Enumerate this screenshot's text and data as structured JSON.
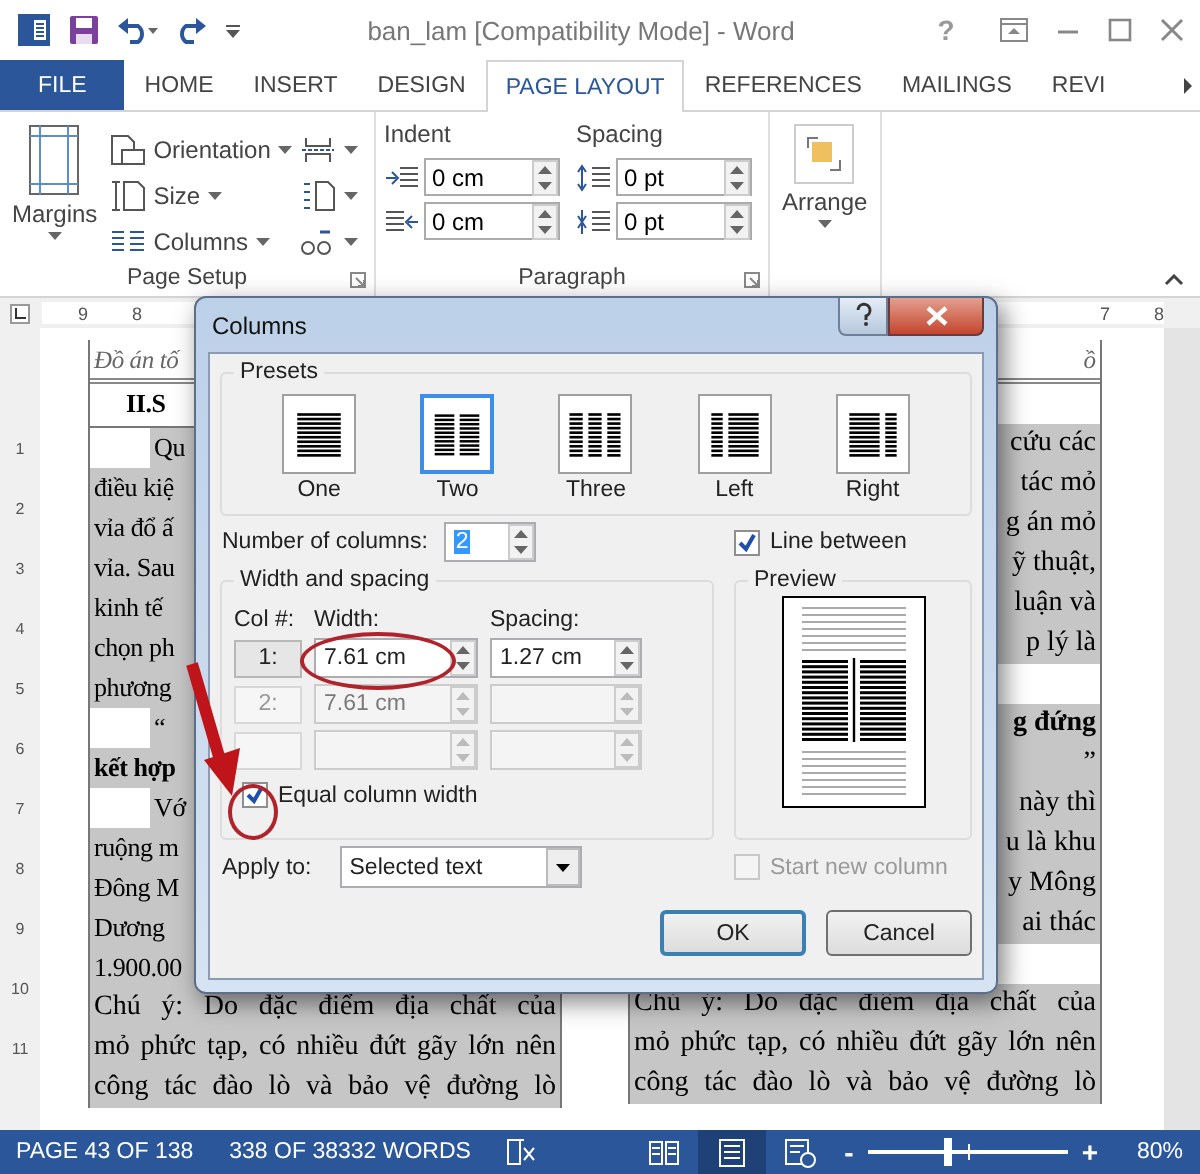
{
  "window": {
    "title": "ban_lam [Compatibility Mode] - Word",
    "help": "?"
  },
  "ribbon_tabs": [
    {
      "label": "FILE",
      "kind": "file",
      "selected": false
    },
    {
      "label": "HOME",
      "kind": "tab",
      "selected": false
    },
    {
      "label": "INSERT",
      "kind": "tab",
      "selected": false
    },
    {
      "label": "DESIGN",
      "kind": "tab",
      "selected": false
    },
    {
      "label": "PAGE LAYOUT",
      "kind": "tab",
      "selected": true
    },
    {
      "label": "REFERENCES",
      "kind": "tab",
      "selected": false
    },
    {
      "label": "MAILINGS",
      "kind": "tab",
      "selected": false
    },
    {
      "label": "REVI",
      "kind": "tab",
      "selected": false
    }
  ],
  "ribbon": {
    "page_setup": {
      "margins": "Margins",
      "orientation": "Orientation",
      "size": "Size",
      "columns": "Columns",
      "label": "Page Setup"
    },
    "paragraph": {
      "indent_label": "Indent",
      "spacing_label": "Spacing",
      "indent_left": "0 cm",
      "indent_right": "0 cm",
      "spacing_before": "0 pt",
      "spacing_after": "0 pt",
      "label": "Paragraph"
    },
    "arrange": "Arrange"
  },
  "ruler": {
    "left_numbers": [
      "9",
      "8"
    ],
    "right_numbers": [
      "7",
      "8"
    ],
    "vertical_numbers": [
      "1",
      "2",
      "3",
      "4",
      "5",
      "6",
      "7",
      "8",
      "9",
      "10",
      "11"
    ]
  },
  "document": {
    "left_column": [
      {
        "kind": "header",
        "text": "Đồ án tố"
      },
      {
        "kind": "heading",
        "text": "II.S"
      },
      {
        "kind": "indent",
        "text": "Qu"
      },
      {
        "kind": "line",
        "text": "điều kiệ"
      },
      {
        "kind": "line",
        "text": "vỉa đổ ấ"
      },
      {
        "kind": "line",
        "text": "vỉa. Sau"
      },
      {
        "kind": "line",
        "text": "kinh tế"
      },
      {
        "kind": "line",
        "text": "chọn ph"
      },
      {
        "kind": "line",
        "text": "phương"
      },
      {
        "kind": "indent",
        "text": "“"
      },
      {
        "kind": "bold",
        "text": "kết hợp"
      },
      {
        "kind": "indent",
        "text": "Vớ"
      },
      {
        "kind": "line",
        "text": "ruộng m"
      },
      {
        "kind": "line",
        "text": "Đông M"
      },
      {
        "kind": "line",
        "text": "Dương"
      },
      {
        "kind": "line",
        "text": "1.900.00"
      },
      {
        "kind": "full",
        "text": "Chú ý: Do đặc điểm địa chất của"
      },
      {
        "kind": "full",
        "text": "mỏ phức tạp, có nhiều đứt gãy lớn nên"
      },
      {
        "kind": "full",
        "text": "công tác đào lò và bảo vệ đường lò"
      }
    ],
    "right_column": [
      {
        "kind": "header",
        "text": "ồ"
      },
      {
        "kind": "blank"
      },
      {
        "kind": "line",
        "text": "cứu các"
      },
      {
        "kind": "line",
        "text": "tác mỏ"
      },
      {
        "kind": "line",
        "text": "g án mỏ"
      },
      {
        "kind": "line",
        "text": "ỹ thuật,"
      },
      {
        "kind": "line",
        "text": "luận và"
      },
      {
        "kind": "line",
        "text": "p lý là"
      },
      {
        "kind": "blank"
      },
      {
        "kind": "bold",
        "text": "g đứng"
      },
      {
        "kind": "line",
        "text": "”"
      },
      {
        "kind": "line",
        "text": "này thì"
      },
      {
        "kind": "line",
        "text": "u là khu"
      },
      {
        "kind": "line",
        "text": "y Mông"
      },
      {
        "kind": "line",
        "text": "ai thác"
      },
      {
        "kind": "blank"
      },
      {
        "kind": "full",
        "text": "Chú ý: Do đặc điểm địa chất của"
      },
      {
        "kind": "full",
        "text": "mỏ phức tạp, có nhiều đứt gãy lớn nên"
      },
      {
        "kind": "full",
        "text": "công tác đào lò và bảo vệ đường lò"
      }
    ]
  },
  "dialog": {
    "title": "Columns",
    "presets_label": "Presets",
    "presets": [
      {
        "label": "One",
        "kind": "one",
        "selected": false
      },
      {
        "label": "Two",
        "kind": "two",
        "selected": true
      },
      {
        "label": "Three",
        "kind": "three",
        "selected": false
      },
      {
        "label": "Left",
        "kind": "left",
        "selected": false
      },
      {
        "label": "Right",
        "kind": "right",
        "selected": false
      }
    ],
    "number_label": "Number of columns:",
    "number_value": "2",
    "line_between": {
      "label": "Line between",
      "checked": true
    },
    "width_spacing_label": "Width and spacing",
    "headers": [
      "Col #:",
      "Width:",
      "Spacing:"
    ],
    "columns": [
      {
        "col": "1:",
        "width": "7.61 cm",
        "spacing": "1.27 cm",
        "disabled": false
      },
      {
        "col": "2:",
        "width": "7.61 cm",
        "disabled": true
      },
      {
        "disabled": true
      }
    ],
    "equal_width": {
      "label": "Equal column width",
      "checked": true
    },
    "preview_label": "Preview",
    "apply_label": "Apply to:",
    "apply_value": "Selected text",
    "start_new": {
      "label": "Start new column",
      "checked": false,
      "disabled": true
    },
    "buttons": [
      {
        "label": "OK",
        "kind": "default"
      },
      {
        "label": "Cancel",
        "kind": "normal"
      }
    ]
  },
  "status_bar": {
    "page": "PAGE 43 OF 138",
    "words": "338 OF 38332 WORDS",
    "views": [
      {
        "kind": "read",
        "selected": false
      },
      {
        "kind": "print",
        "selected": true
      },
      {
        "kind": "web",
        "selected": false
      }
    ],
    "zoom_minus": "-",
    "zoom_slider": {
      "level": 0.4
    },
    "zoom_plus": "+",
    "zoom": "80%"
  }
}
